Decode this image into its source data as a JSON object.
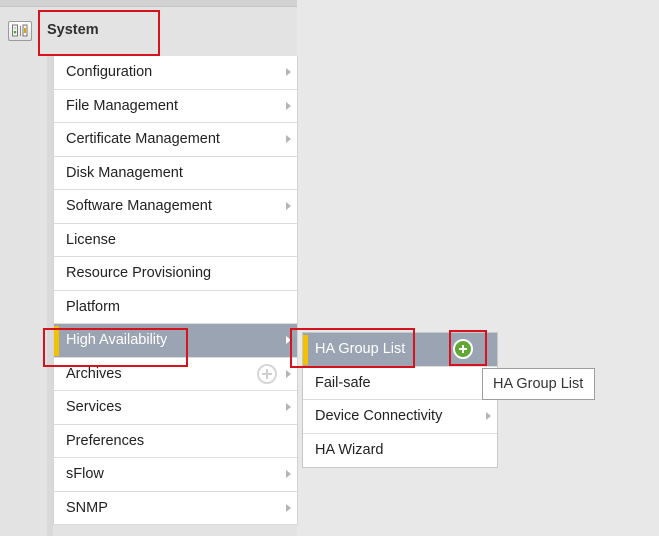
{
  "system": {
    "title": "System",
    "icon": "system-settings-icon"
  },
  "menu": {
    "items": [
      {
        "label": "Configuration",
        "has_submenu": true
      },
      {
        "label": "File Management",
        "has_submenu": true
      },
      {
        "label": "Certificate Management",
        "has_submenu": true
      },
      {
        "label": "Disk Management",
        "has_submenu": false
      },
      {
        "label": "Software Management",
        "has_submenu": true
      },
      {
        "label": "License",
        "has_submenu": false
      },
      {
        "label": "Resource Provisioning",
        "has_submenu": false
      },
      {
        "label": "Platform",
        "has_submenu": false
      },
      {
        "label": "High Availability",
        "has_submenu": true,
        "active": true
      },
      {
        "label": "Archives",
        "has_submenu": true,
        "add_icon": true
      },
      {
        "label": "Services",
        "has_submenu": true
      },
      {
        "label": "Preferences",
        "has_submenu": false
      },
      {
        "label": "sFlow",
        "has_submenu": true
      },
      {
        "label": "SNMP",
        "has_submenu": true
      }
    ]
  },
  "submenu": {
    "items": [
      {
        "label": "HA Group List",
        "active": true,
        "add_icon": true
      },
      {
        "label": "Fail-safe",
        "has_submenu": false
      },
      {
        "label": "Device Connectivity",
        "has_submenu": true
      },
      {
        "label": "HA Wizard",
        "has_submenu": false
      }
    ]
  },
  "tooltip": {
    "text": "HA Group List"
  },
  "colors": {
    "active_row": "#9aa4b2",
    "active_marker": "#f2c200",
    "add_button_green": "#5fa834",
    "highlight_box": "#d6131c"
  }
}
